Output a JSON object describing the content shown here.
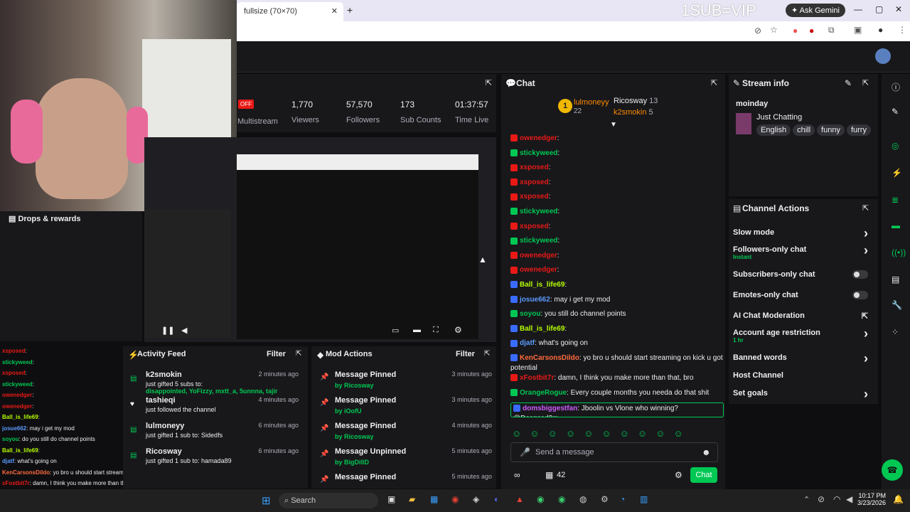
{
  "browser": {
    "tab_title": "fullsize (70×70)",
    "overlay_text": "1SUB=VIP",
    "gemini_label": "Ask Gemini"
  },
  "stats": {
    "offline_badge": "OFF",
    "multistream_label": "Multistream",
    "items": [
      {
        "value": "1,770",
        "label": "Viewers"
      },
      {
        "value": "57,570",
        "label": "Followers"
      },
      {
        "value": "173",
        "label": "Sub Counts"
      },
      {
        "value": "01:37:57",
        "label": "Time Live"
      }
    ]
  },
  "chat": {
    "title": "Chat",
    "leaderboard": [
      {
        "name": "lulmoneyy",
        "count": "22"
      },
      {
        "name": "Ricosway",
        "count": "13"
      },
      {
        "name": "k2smokin",
        "count": "5"
      }
    ],
    "lines": [
      {
        "user": "owenedger",
        "text": ":",
        "cls": "u-red"
      },
      {
        "user": "stickyweed",
        "text": ":",
        "cls": "u-green"
      },
      {
        "user": "xsposed",
        "text": ":",
        "cls": "u-red"
      },
      {
        "user": "xsposed",
        "text": ":",
        "cls": "u-red"
      },
      {
        "user": "xsposed",
        "text": ":",
        "cls": "u-red"
      },
      {
        "user": "stickyweed",
        "text": ":",
        "cls": "u-green"
      },
      {
        "user": "xsposed",
        "text": ":",
        "cls": "u-red"
      },
      {
        "user": "stickyweed",
        "text": ":",
        "cls": "u-green"
      },
      {
        "user": "owenedger",
        "text": ":",
        "cls": "u-red"
      },
      {
        "user": "owenedger",
        "text": ":",
        "cls": "u-red"
      },
      {
        "user": "Ball_is_life69",
        "text": ":",
        "cls": "u-lime"
      },
      {
        "user": "josue662",
        "text": ": may i get my mod",
        "cls": "u-blue"
      },
      {
        "user": "soyou",
        "text": ": you still do channel points",
        "cls": "u-green"
      },
      {
        "user": "Ball_is_life69",
        "text": ":",
        "cls": "u-lime"
      },
      {
        "user": "djatf",
        "text": ": what's going on",
        "cls": "u-blue"
      },
      {
        "user": "KenCarsonsDildo",
        "text": ": yo bro u should start streaming on kick u got potential",
        "cls": "u-orange"
      },
      {
        "user": "xFostbit7r",
        "text": ": damn, I think you make more than that, bro",
        "cls": "u-red"
      },
      {
        "user": "OrangeRogue",
        "text": ": Every couple months you needa do that shit",
        "cls": "u-green"
      },
      {
        "user": "domsbiggestfan",
        "text": ": Jboolin vs Vlone who winning? @Dasgasd3m",
        "cls": "u-mag"
      }
    ],
    "input_placeholder": "Send a message",
    "points": "42",
    "chat_button": "Chat"
  },
  "stream_info": {
    "title": "Stream info",
    "channel": "moinday",
    "category": "Just Chatting",
    "tags": [
      "English",
      "chill",
      "funny",
      "furry"
    ]
  },
  "channel_actions": {
    "title": "Channel Actions",
    "items": [
      {
        "label": "Slow mode",
        "sub": ""
      },
      {
        "label": "Followers-only chat",
        "sub": "Instant"
      },
      {
        "label": "Subscribers-only chat",
        "sub": ""
      },
      {
        "label": "Emotes-only chat",
        "sub": ""
      },
      {
        "label": "AI Chat Moderation",
        "sub": ""
      },
      {
        "label": "Account age restriction",
        "sub": "1 hr"
      },
      {
        "label": "Banned words",
        "sub": ""
      },
      {
        "label": "Host Channel",
        "sub": ""
      },
      {
        "label": "Set goals",
        "sub": ""
      }
    ]
  },
  "activity": {
    "title": "Activity Feed",
    "filter": "Filter",
    "items": [
      {
        "name": "k2smokin",
        "time": "2 minutes ago",
        "line1": "just gifted 5 subs to:",
        "line2": "disappointed, YoFizzy, mxtt_a, 5unnna, tajir"
      },
      {
        "name": "tashieqi",
        "time": "4 minutes ago",
        "line1": "just followed the channel",
        "line2": ""
      },
      {
        "name": "lulmoneyy",
        "time": "6 minutes ago",
        "line1": "just gifted 1 sub to: Sidedfs",
        "line2": ""
      },
      {
        "name": "Ricosway",
        "time": "6 minutes ago",
        "line1": "just gifted 1 sub to: hamada89",
        "line2": ""
      }
    ]
  },
  "mod": {
    "title": "Mod Actions",
    "filter": "Filter",
    "items": [
      {
        "action": "Message Pinned",
        "by": "by Ricosway",
        "time": "3 minutes ago"
      },
      {
        "action": "Message Pinned",
        "by": "by iOofU",
        "time": "3 minutes ago"
      },
      {
        "action": "Message Pinned",
        "by": "by Ricosway",
        "time": "4 minutes ago"
      },
      {
        "action": "Message Unpinned",
        "by": "by BigDillD",
        "time": "5 minutes ago"
      },
      {
        "action": "Message Pinned",
        "by": "",
        "time": "5 minutes ago"
      }
    ]
  },
  "left": {
    "drops_label": "Drops & rewards",
    "chat": [
      {
        "user": "xsposed",
        "text": ":",
        "cls": "u-red"
      },
      {
        "user": "stickyweed",
        "text": ":",
        "cls": "u-green"
      },
      {
        "user": "xsposed",
        "text": ":",
        "cls": "u-red"
      },
      {
        "user": "stickyweed",
        "text": ":",
        "cls": "u-green"
      },
      {
        "user": "owenedger",
        "text": ":",
        "cls": "u-red"
      },
      {
        "user": "owenedger",
        "text": ":",
        "cls": "u-red"
      },
      {
        "user": "Ball_is_life69",
        "text": ":",
        "cls": "u-lime"
      },
      {
        "user": "josue662",
        "text": ": may i get my mod",
        "cls": "u-blue"
      },
      {
        "user": "soyou",
        "text": ": do you still do channel points",
        "cls": "u-green"
      },
      {
        "user": "Ball_is_life69",
        "text": ":",
        "cls": "u-lime"
      },
      {
        "user": "djatf",
        "text": ": what's going on",
        "cls": "u-blue"
      },
      {
        "user": "KenCarsonsDildo",
        "text": ": yo bro u should start streaming on kick u got potential",
        "cls": "u-orange"
      },
      {
        "user": "xFostbit7r",
        "text": ": damn, I think you make more than that, bro",
        "cls": "u-red"
      },
      {
        "user": "OrangeRogue",
        "text": ": Every couple months you needa do that shit",
        "cls": "u-green"
      },
      {
        "user": "domsbiggestfan",
        "text": ": Jboolin vs Vlone who winning? @Dasgasd3m",
        "cls": "u-mag"
      }
    ]
  },
  "taskbar": {
    "search": "Search",
    "time": "10:17 PM",
    "date": "3/23/2026"
  }
}
